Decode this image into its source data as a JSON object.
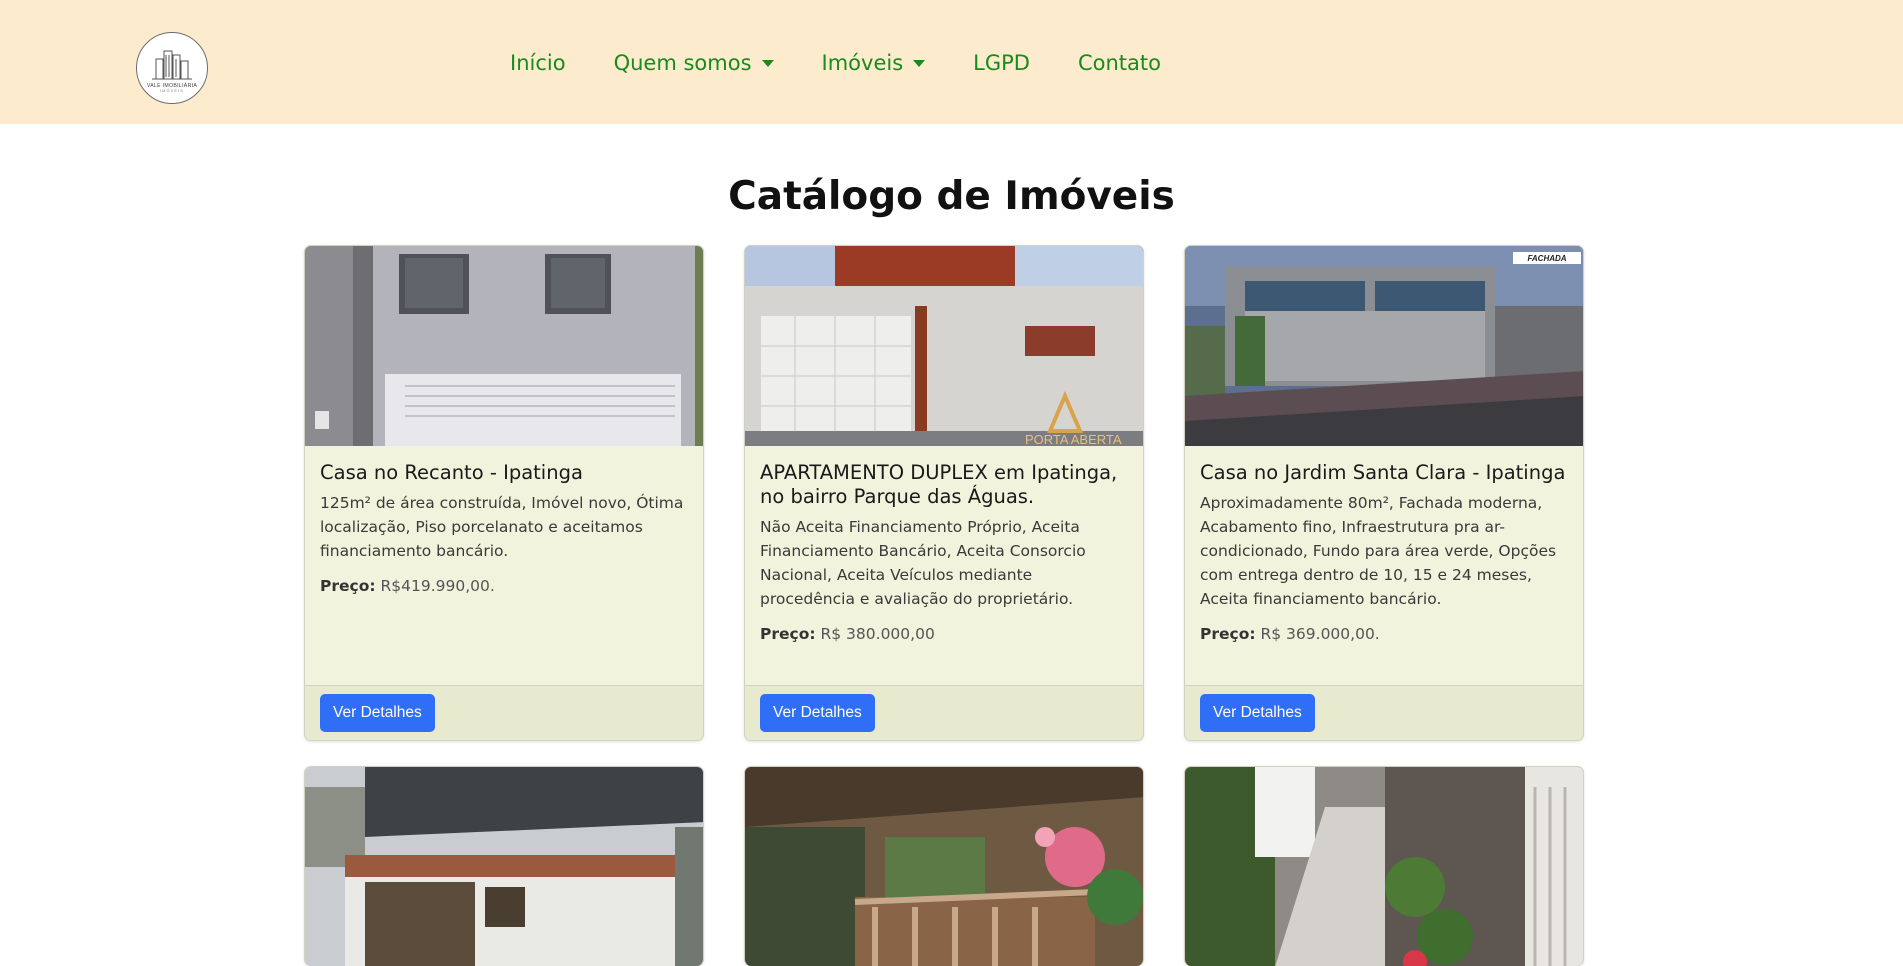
{
  "brand": {
    "logo_text": "VALE IMOBILIÁRIA",
    "logo_sub": "IMÓVEIS"
  },
  "nav": {
    "items": [
      {
        "label": "Início",
        "dropdown": false
      },
      {
        "label": "Quem somos",
        "dropdown": true
      },
      {
        "label": "Imóveis",
        "dropdown": true
      },
      {
        "label": "LGPD",
        "dropdown": false
      },
      {
        "label": "Contato",
        "dropdown": false
      }
    ]
  },
  "page": {
    "title": "Catálogo de Imóveis"
  },
  "cards": [
    {
      "title": "Casa no Recanto - Ipatinga",
      "description": "125m² de área construída, Imóvel novo, Ótima localização, Piso porcelanato e aceitamos financiamento bancário.",
      "price_label": "Preço:",
      "price": "R$419.990,00.",
      "button": "Ver Detalhes"
    },
    {
      "title": "APARTAMENTO DUPLEX em Ipatinga, no bairro Parque das Águas.",
      "description": "Não Aceita Financiamento Próprio, Aceita Financiamento Bancário, Aceita Consorcio Nacional, Aceita Veículos mediante procedência e avaliação do proprietário.",
      "price_label": "Preço:",
      "price": "R$ 380.000,00",
      "button": "Ver Detalhes",
      "image_overlay": "PORTA ABERTA"
    },
    {
      "title": "Casa no Jardim Santa Clara - Ipatinga",
      "description": "Aproximadamente 80m², Fachada moderna, Acabamento fino, Infraestrutura pra ar-condicionado, Fundo para área verde, Opções com entrega dentro de 10, 15 e 24 meses, Aceita financiamento bancário.",
      "price_label": "Preço:",
      "price": "R$ 369.000,00.",
      "button": "Ver Detalhes",
      "image_overlay": "FACHADA"
    }
  ]
}
